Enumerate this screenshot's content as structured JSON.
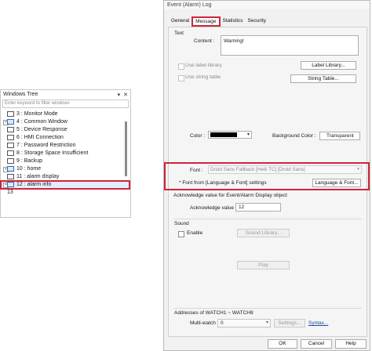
{
  "tree": {
    "title": "Windows Tree",
    "pin_glyph": "▾",
    "close_glyph": "✕",
    "filter_placeholder": "Enter keyword to filter windows",
    "items": [
      {
        "label": "3 : Monitor Mode",
        "expandable": false
      },
      {
        "label": "4 : Common Window",
        "expandable": true
      },
      {
        "label": "5 : Device Response",
        "expandable": false
      },
      {
        "label": "6 : HMI Connection",
        "expandable": false
      },
      {
        "label": "7 : Password Restriction",
        "expandable": false
      },
      {
        "label": "8 : Storage Space Insufficient",
        "expandable": false
      },
      {
        "label": "9 : Backup",
        "expandable": false
      },
      {
        "label": "10 : home",
        "expandable": true
      },
      {
        "label": "11 : alarm display",
        "expandable": false
      },
      {
        "label": "12 : alarm info",
        "expandable": true,
        "selected": true
      },
      {
        "label": "13",
        "expandable": false
      }
    ]
  },
  "dialog": {
    "title": "Event (Alarm) Log",
    "tabs": [
      "General",
      "Message",
      "Statistics",
      "Security"
    ],
    "active_tab": "Message",
    "text_section": {
      "header": "Text",
      "content_label": "Content :",
      "content_value": "Warning!",
      "use_label_library": "Use label library",
      "label_library_btn": "Label Library...",
      "use_string_table": "Use string table",
      "string_table_btn": "String Table...",
      "color_label": "Color :",
      "bg_color_label": "Background Color :",
      "bg_color_value": "Transparent",
      "font_label": "Font :",
      "font_value": "Droid Sans Fallback [Heiti TC] [Droid Sans]",
      "font_note": "* Font from [Language & Font] settings",
      "lang_font_btn": "Language & Font..."
    },
    "ack_section": {
      "header": "Acknowledge value for Event/Alarm Display object",
      "label": "Acknowledge value :",
      "value": "12"
    },
    "sound_section": {
      "header": "Sound",
      "enable_label": "Enable",
      "library_btn": "Sound Library...",
      "play_btn": "Play"
    },
    "watch_section": {
      "header": "Addresses of WATCH1 ~ WATCH8",
      "multi_label": "Multi-watch :",
      "multi_value": "0",
      "settings_btn": "Settings...",
      "syntax_link": "Syntax..."
    },
    "footer": {
      "ok": "OK",
      "cancel": "Cancel",
      "help": "Help"
    }
  },
  "colors": {
    "highlight_red": "#d0243a",
    "color_swatch": "#000000",
    "link": "#1a4fa0"
  }
}
